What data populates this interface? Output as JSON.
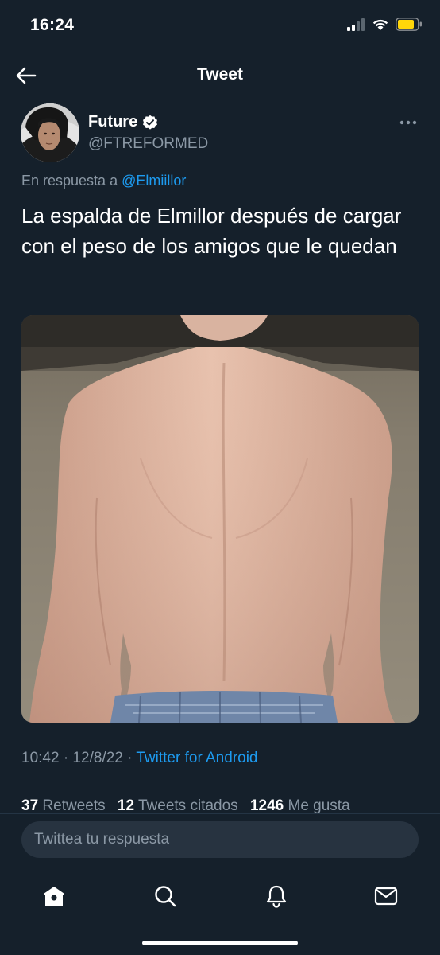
{
  "status_bar": {
    "time": "16:24"
  },
  "nav": {
    "title": "Tweet"
  },
  "tweet": {
    "author_name": "Future",
    "author_handle": "@FTREFORMED",
    "reply_prefix": "En respuesta a",
    "reply_to": "@Elmiillor",
    "text": "La espalda de Elmillor después de cargar con el peso de los amigos que le quedan",
    "timestamp": "10:42 · 12/8/22 ·",
    "source": "Twitter for Android"
  },
  "stats": {
    "retweets_count": "37",
    "retweets_label": "Retweets",
    "quotes_count": "12",
    "quotes_label": "Tweets citados",
    "likes_count": "1246",
    "likes_label": "Me gusta"
  },
  "reply": {
    "placeholder": "Twittea tu respuesta"
  },
  "tabs": [
    "home-icon",
    "search-icon",
    "notifications-icon",
    "messages-icon"
  ],
  "colors": {
    "background": "#15202b",
    "accent": "#1d9bf0",
    "secondary_text": "#8b98a5"
  }
}
